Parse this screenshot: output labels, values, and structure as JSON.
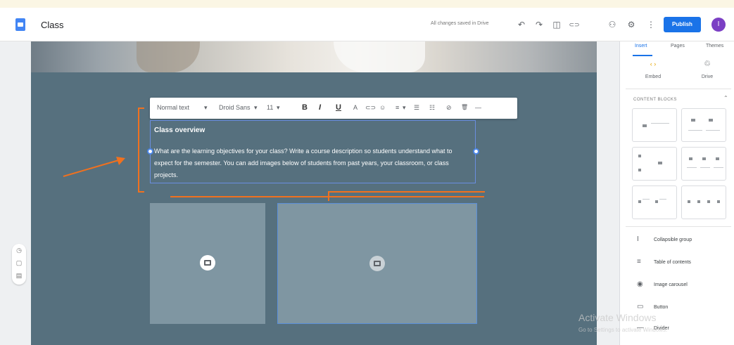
{
  "app": {
    "doc_title": "Class",
    "saved_status": "All changes saved in Drive",
    "publish_label": "Publish",
    "avatar_initial": "I"
  },
  "toolbar": {
    "undo": "↶",
    "redo": "↷",
    "preview": "◫",
    "link": "⊂⊃",
    "add_user": "⚇",
    "settings": "⚙",
    "more": "⋮"
  },
  "format_bar": {
    "style": "Normal text",
    "font": "Droid Sans",
    "size": "11",
    "bold": "B",
    "italic": "I",
    "underline": "U",
    "color": "A",
    "link": "⊂⊃",
    "emoji": "☺",
    "align": "≡",
    "bullets": "☰",
    "numbered": "☷",
    "clear": "⊘",
    "delete": "🗑",
    "more": "—"
  },
  "textbox": {
    "heading": "Class overview",
    "body": "What are the learning objectives for your class? Write a course description so students understand what to expect for the semester. You can add images below of students from past years, your classroom, or class projects."
  },
  "left_tools": [
    "◷",
    "▢",
    "▤"
  ],
  "right_panel": {
    "tabs": [
      "Insert",
      "Pages",
      "Themes"
    ],
    "embed_label": "Embed",
    "drive_label": "Drive",
    "content_blocks_label": "CONTENT BLOCKS",
    "items": [
      {
        "icon": "I",
        "label": "Collapsible group"
      },
      {
        "icon": "≡",
        "label": "Table of contents"
      },
      {
        "icon": "◉",
        "label": "Image carousel"
      },
      {
        "icon": "▭",
        "label": "Button"
      },
      {
        "icon": "—",
        "label": "Divider"
      }
    ]
  },
  "windows": {
    "line1": "Activate Windows",
    "line2": "Go to Settings to activate Windows."
  },
  "annotation_color": "#f0711f"
}
